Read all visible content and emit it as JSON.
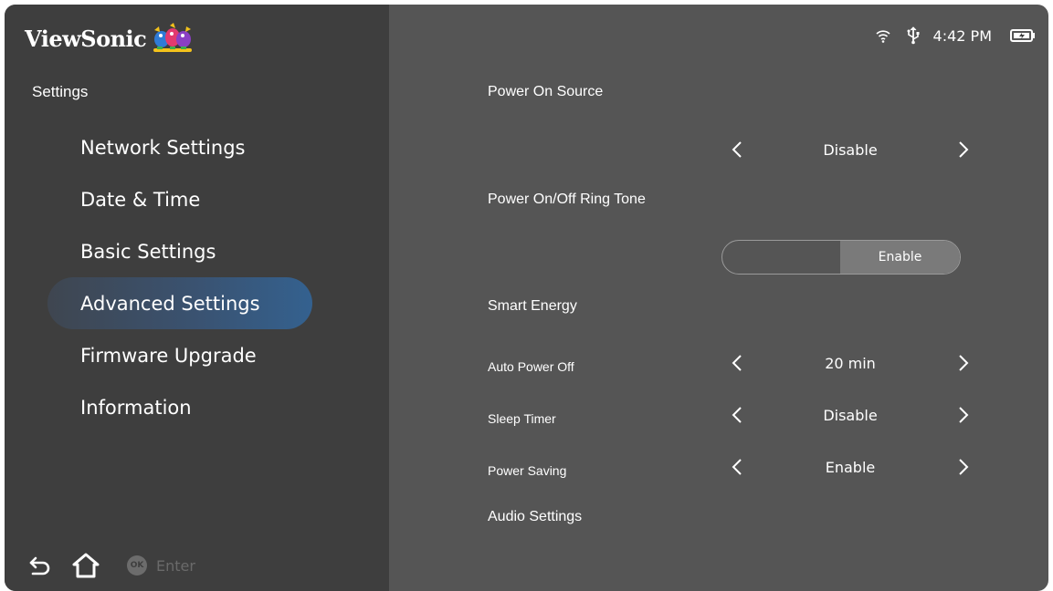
{
  "brand": {
    "name": "ViewSonic"
  },
  "sidebar": {
    "title": "Settings",
    "items": [
      {
        "label": "Network Settings",
        "active": false
      },
      {
        "label": "Date & Time",
        "active": false
      },
      {
        "label": "Basic Settings",
        "active": false
      },
      {
        "label": "Advanced Settings",
        "active": true
      },
      {
        "label": "Firmware Upgrade",
        "active": false
      },
      {
        "label": "Information",
        "active": false
      }
    ],
    "footer": {
      "ok_label": "OK",
      "enter_label": "Enter"
    }
  },
  "status": {
    "time": "4:42 PM",
    "icons": [
      "wifi-icon",
      "usb-icon",
      "battery-icon"
    ]
  },
  "main": {
    "power_on_source": {
      "label": "Power On Source",
      "value": "Disable"
    },
    "ring_tone": {
      "label": "Power On/Off Ring Tone",
      "value": "Enable"
    },
    "smart_energy": {
      "label": "Smart Energy"
    },
    "auto_power_off": {
      "label": "Auto Power Off",
      "value": "20 min"
    },
    "sleep_timer": {
      "label": "Sleep Timer",
      "value": "Disable"
    },
    "power_saving": {
      "label": "Power Saving",
      "value": "Enable"
    },
    "audio_settings": {
      "label": "Audio Settings"
    }
  },
  "colors": {
    "sidebar_bg": "#3e3e3e",
    "content_bg": "#555555",
    "active_item": "#34618f",
    "toggle_on": "#7a7a7a"
  }
}
